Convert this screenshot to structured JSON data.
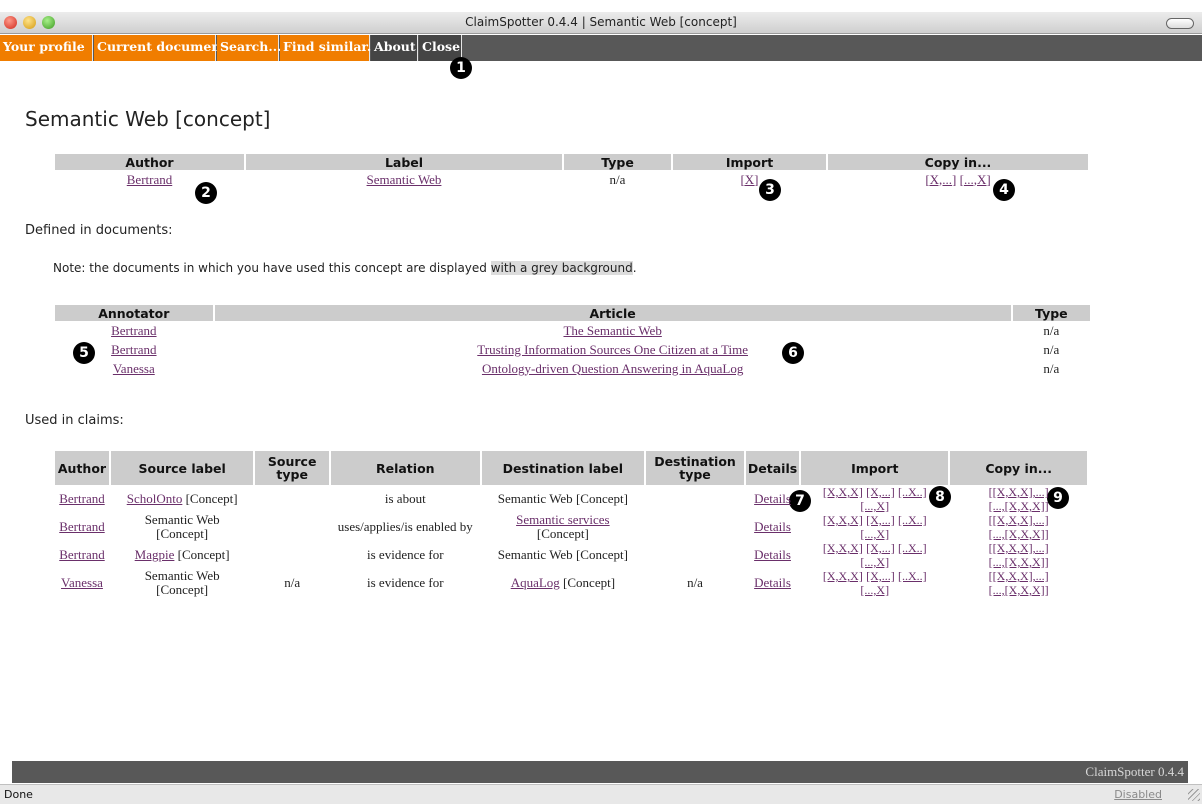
{
  "window": {
    "title": "ClaimSpotter 0.4.4 | Semantic Web [concept]"
  },
  "menu": {
    "your_profile": "Your profile",
    "current_document": "Current document",
    "search": "Search...",
    "find_similar": "Find similar...",
    "about": "About",
    "close": "Close"
  },
  "markers": [
    "1",
    "2",
    "3",
    "4",
    "5",
    "6",
    "7",
    "8",
    "9"
  ],
  "page_title": "Semantic Web [concept]",
  "concept_table": {
    "headers": [
      "Author",
      "Label",
      "Type",
      "Import",
      "Copy in..."
    ],
    "row": {
      "author": "Bertrand",
      "label": "Semantic Web",
      "type": "n/a",
      "import": "[X]",
      "copy1": "[X,...]",
      "copy2": "[...,X]"
    }
  },
  "defined_heading": "Defined in documents:",
  "note": {
    "prefix": "Note: the documents in which you have used this concept are displayed ",
    "highlight": "with a grey background",
    "suffix": "."
  },
  "docs_table": {
    "headers": [
      "Annotator",
      "Article",
      "Type"
    ],
    "rows": [
      {
        "annotator": "Bertrand",
        "article": "The Semantic Web",
        "type": "n/a"
      },
      {
        "annotator": "Bertrand",
        "article": "Trusting Information Sources One Citizen at a Time",
        "type": "n/a"
      },
      {
        "annotator": "Vanessa",
        "article": "Ontology-driven Question Answering in AquaLog",
        "type": "n/a"
      }
    ]
  },
  "claims_heading": "Used in claims:",
  "claims_table": {
    "headers": [
      "Author",
      "Source label",
      "Source type",
      "Relation",
      "Destination label",
      "Destination type",
      "Details",
      "Import",
      "Copy in..."
    ],
    "concept_tag": "[Concept]",
    "import_links": [
      "[X,X,X]",
      "[X,...]",
      "[..X..]",
      "[...,X]"
    ],
    "copy_links": [
      "[[X,X,X],...]",
      "[...,[X,X,X]]"
    ],
    "rows": [
      {
        "author": "Bertrand",
        "source_link": "ScholOnto",
        "source_text": "",
        "source_type": "",
        "relation": "is about",
        "dest_link": "",
        "dest_text": "Semantic Web",
        "dest_type": "",
        "details": "Details"
      },
      {
        "author": "Bertrand",
        "source_link": "",
        "source_text": "Semantic Web",
        "source_type": "",
        "relation": "uses/applies/is enabled by",
        "dest_link": "Semantic services",
        "dest_text": "",
        "dest_type": "",
        "details": "Details"
      },
      {
        "author": "Bertrand",
        "source_link": "Magpie",
        "source_text": "",
        "source_type": "",
        "relation": "is evidence for",
        "dest_link": "",
        "dest_text": "Semantic Web",
        "dest_type": "",
        "details": "Details"
      },
      {
        "author": "Vanessa",
        "source_link": "",
        "source_text": "Semantic Web",
        "source_type": "n/a",
        "relation": "is evidence for",
        "dest_link": "AquaLog",
        "dest_text": "",
        "dest_type": "n/a",
        "details": "Details"
      }
    ]
  },
  "footer": {
    "brand": "ClaimSpotter 0.4.4"
  },
  "status": {
    "left": "Done",
    "right": "Disabled"
  }
}
